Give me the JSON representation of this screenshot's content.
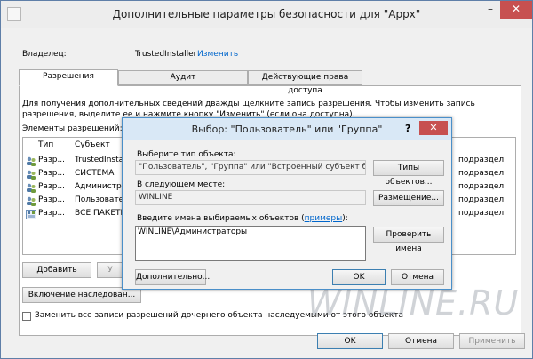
{
  "window": {
    "title": "Дополнительные параметры безопасности  для \"Appx\"",
    "min_label": "–",
    "close_label": "✕"
  },
  "owner": {
    "label": "Владелец:",
    "value": "TrustedInstaller",
    "change_link": "Изменить"
  },
  "tabs": [
    {
      "label": "Разрешения"
    },
    {
      "label": "Аудит"
    },
    {
      "label": "Действующие права доступа"
    }
  ],
  "permissions": {
    "description": "Для получения дополнительных сведений дважды щелкните запись разрешения. Чтобы изменить запись разрешения, выделите ее и нажмите кнопку \"Изменить\" (если она доступна).",
    "list_label": "Элементы разрешений:",
    "columns": {
      "type": "Тип",
      "subject": "Субъект"
    },
    "rows": [
      {
        "type": "Разр...",
        "subject": "TrustedInstall",
        "tail": "подраздел"
      },
      {
        "type": "Разр...",
        "subject": "СИСТЕМА",
        "tail": "подраздел"
      },
      {
        "type": "Разр...",
        "subject": "Администрат",
        "tail": "подраздел"
      },
      {
        "type": "Разр...",
        "subject": "Пользовате",
        "tail": "подраздел"
      },
      {
        "type": "Разр...",
        "subject": "ВСЕ ПАКЕТЫ",
        "tail": "подраздел"
      }
    ],
    "add_button": "Добавить",
    "remove_button": "У",
    "inherit_button": "Включение наследован...",
    "replace_checkbox": "Заменить все записи разрешений дочернего объекта наследуемыми от этого объекта"
  },
  "footer": {
    "ok": "OK",
    "cancel": "Отмена",
    "apply": "Применить"
  },
  "watermark": "WINLINE.RU",
  "dialog": {
    "title": "Выбор: \"Пользователь\" или \"Группа\"",
    "help": "?",
    "close": "✕",
    "object_type_label": "Выберите тип объекта:",
    "object_type_value": "\"Пользователь\", \"Группа\" или \"Встроенный субъект безопаснос",
    "object_types_button": "Типы объектов...",
    "location_label": "В следующем месте:",
    "location_value": "WINLINE",
    "location_button": "Размещение...",
    "names_label_prefix": "Введите имена выбираемых объектов (",
    "names_label_link": "примеры",
    "names_label_suffix": "):",
    "names_value": "WINLINE\\Администраторы",
    "check_names_button": "Проверить имена",
    "advanced_button": "Дополнительно...",
    "ok": "OK",
    "cancel": "Отмена"
  }
}
